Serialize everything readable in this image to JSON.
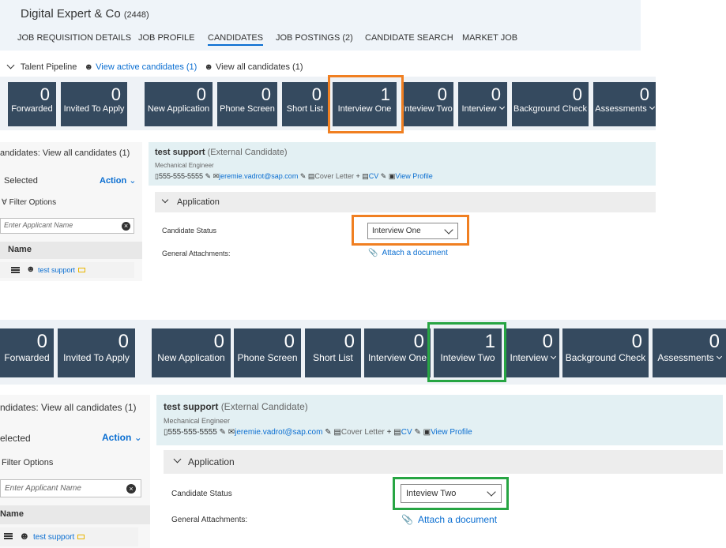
{
  "header": {
    "company": "Digital Expert & Co",
    "company_id": "(2448)",
    "tabs": [
      "JOB REQUISITION DETAILS",
      "JOB PROFILE",
      "CANDIDATES",
      "JOB POSTINGS (2)",
      "CANDIDATE SEARCH",
      "MARKET JOB"
    ]
  },
  "pipeline": {
    "label": "Talent Pipeline",
    "active_link": "View active candidates (1)",
    "all_link": "View all candidates (1)"
  },
  "top_tiles": [
    {
      "count": "0",
      "label": "Forwarded"
    },
    {
      "count": "0",
      "label": "Invited To Apply"
    },
    {
      "count": "0",
      "label": "New Application"
    },
    {
      "count": "0",
      "label": "Phone Screen"
    },
    {
      "count": "0",
      "label": "Short List"
    },
    {
      "count": "1",
      "label": "Interview One"
    },
    {
      "count": "0",
      "label": "Inteview Two"
    },
    {
      "count": "0",
      "label": "Interview"
    },
    {
      "count": "0",
      "label": "Background Check"
    },
    {
      "count": "0",
      "label": "Assessments"
    }
  ],
  "bottom_tiles": [
    {
      "count": "0",
      "label": "Forwarded"
    },
    {
      "count": "0",
      "label": "Invited To Apply"
    },
    {
      "count": "0",
      "label": "New Application"
    },
    {
      "count": "0",
      "label": "Phone Screen"
    },
    {
      "count": "0",
      "label": "Short List"
    },
    {
      "count": "0",
      "label": "Interview One"
    },
    {
      "count": "1",
      "label": "Inteview Two"
    },
    {
      "count": "0",
      "label": "Interview"
    },
    {
      "count": "0",
      "label": "Background Check"
    },
    {
      "count": "0",
      "label": "Assessments"
    }
  ],
  "left_panel": {
    "title_top": "andidates: View all candidates (1)",
    "title_bottom": "ndidates: View all candidates (1)",
    "selected_top": "Selected",
    "selected_bottom": "elected",
    "action": "Action",
    "filter": "Filter Options",
    "search_placeholder": "Enter Applicant Name",
    "name_header": "Name",
    "applicant": "test support"
  },
  "candidate": {
    "name": "test support",
    "type": "(External Candidate)",
    "role": "Mechanical Engineer",
    "phone": "555-555-5555",
    "email": "jeremie.vadrot@sap.com",
    "cover_letter": "Cover Letter",
    "cv": "CV",
    "view_profile": "View Profile"
  },
  "application": {
    "section": "Application",
    "status_label": "Candidate Status",
    "status_top": "Interview One",
    "status_bottom": "Inteview Two",
    "attachments_label": "General Attachments:",
    "attach_link": "Attach a document"
  },
  "colors": {
    "tile": "#354a5f",
    "highlight_top": "#f07f21",
    "highlight_bottom": "#27a543",
    "link": "#0a6ed1"
  }
}
